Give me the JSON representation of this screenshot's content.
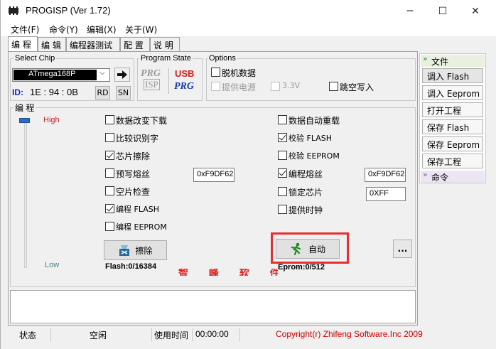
{
  "title": "PROGISP (Ver 1.72)",
  "window_controls": {
    "minimize": "─",
    "maximize": "☐",
    "close": "✕"
  },
  "menu": [
    "文件(F)",
    "命令(Y)",
    "编辑(X)",
    "关于(W)"
  ],
  "tabs": [
    "编 程",
    "编 辑",
    "编程器测试",
    "配 置",
    "说 明"
  ],
  "select_chip": {
    "group_label": "Select Chip",
    "value": "ATmega168P",
    "id_label": "ID:",
    "id_value": "1E : 94 : 0B",
    "rd_button": "RD",
    "sn_button": "SN"
  },
  "program_state": {
    "group_label": "Program State",
    "logo_left_top": "PRG",
    "logo_left_bottom": "ISP",
    "logo_right_top": "USB",
    "logo_right_bottom": "PRG"
  },
  "options": {
    "group_label": "Options",
    "items": [
      {
        "label": "脱机数据",
        "checked": false,
        "disabled": false
      },
      {
        "label": "提供电源",
        "checked": false,
        "disabled": true
      },
      {
        "label": "3.3V",
        "checked": false,
        "disabled": true
      },
      {
        "label": "跳空写入",
        "checked": false,
        "disabled": false
      }
    ]
  },
  "program": {
    "group_label": "编 程",
    "slider_high": "High",
    "slider_low": "Low",
    "left_items": [
      {
        "label": "数据改变下载",
        "checked": false
      },
      {
        "label": "比较识别字",
        "checked": false
      },
      {
        "label": "芯片擦除",
        "checked": true
      },
      {
        "label": "预写熔丝",
        "checked": false
      },
      {
        "label": "空片检查",
        "checked": false
      },
      {
        "label": "编程 FLASH",
        "checked": true
      },
      {
        "label": "编程 EEPROM",
        "checked": false
      }
    ],
    "right_items": [
      {
        "label": "数据自动重载",
        "checked": false
      },
      {
        "label": "校验 FLASH",
        "checked": true
      },
      {
        "label": "校验 EEPROM",
        "checked": false
      },
      {
        "label": "编程熔丝",
        "checked": true
      },
      {
        "label": "锁定芯片",
        "checked": false
      },
      {
        "label": "提供时钟",
        "checked": false
      }
    ],
    "prewrite_fuse_value": "0xF9DF62",
    "program_fuse_value": "0xF9DF62",
    "lock_value": "0XFF",
    "erase_button": "擦除",
    "auto_button": "自动",
    "more_button": "...",
    "flash_info": "Flash:0/16384",
    "eeprom_info": "Eprom:0/512",
    "watermark": "智 峰 软 件"
  },
  "side_panel": {
    "file_section": "文件",
    "buttons": [
      "调入 Flash",
      "调入 Eeprom",
      "打开工程",
      "保存 Flash",
      "保存 Eeprom",
      "保存工程"
    ],
    "command_section": "命令"
  },
  "status_bar": {
    "state_label": "状态",
    "state_value": "空闲",
    "time_label": "使用时间",
    "time_value": "00:00:00",
    "copyright": "Copyright(r) Zhifeng Software.Inc 2009"
  },
  "colors": {
    "highlight_red": "#e53030",
    "copyright_red": "#cc0000",
    "slider_blue": "#2b6cc4"
  }
}
